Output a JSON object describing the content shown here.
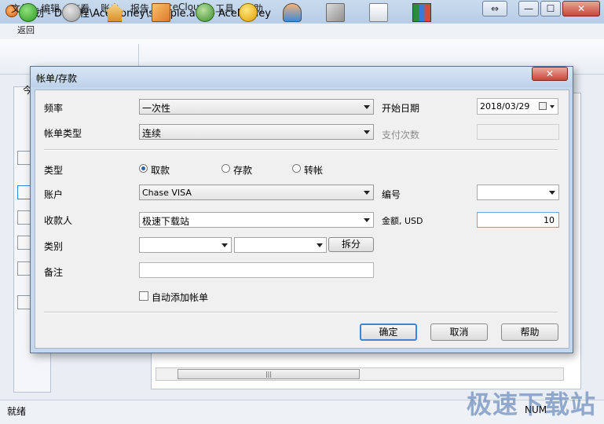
{
  "app": {
    "title": "计划 - D:\\教程\\AceMoney\\sample.amj - AceMoney",
    "window_buttons": {
      "restore": "⇔",
      "minimize": "—",
      "maximize": "☐",
      "close": "✕"
    }
  },
  "menu": [
    "文件",
    "编辑",
    "查看",
    "账户",
    "报告",
    "AceCloud",
    "工具",
    "帮助"
  ],
  "toolbar": {
    "back_label": "返回",
    "icons": [
      "back-icon",
      "forward-icon",
      "home-icon",
      "accounts-icon",
      "transfer-icon",
      "payment-icon",
      "payees-icon",
      "categories-icon",
      "schedule-icon",
      "reports-icon"
    ]
  },
  "background": {
    "left_panel_label": "今"
  },
  "dialog": {
    "title": "帐单/存款",
    "close": "✕",
    "frequency": {
      "label": "频率",
      "value": "一次性"
    },
    "start_date": {
      "label": "开始日期",
      "value": "2018/03/29"
    },
    "bill_type": {
      "label": "帐单类型",
      "value": "连续"
    },
    "payment_count": {
      "label": "支付次数",
      "value": ""
    },
    "type": {
      "label": "类型",
      "options": [
        "取款",
        "存款",
        "转帐"
      ],
      "selected": "取款"
    },
    "account": {
      "label": "账户",
      "value": "Chase VISA"
    },
    "number": {
      "label": "编号",
      "value": ""
    },
    "payee": {
      "label": "收款人",
      "value": "极速下载站"
    },
    "amount": {
      "label": "金额, USD",
      "value": "10"
    },
    "category": {
      "label": "类别",
      "value1": "",
      "value2": "",
      "split_label": "拆分"
    },
    "note": {
      "label": "备注",
      "value": ""
    },
    "auto_add": {
      "label": "自动添加帐单",
      "checked": false
    },
    "buttons": {
      "ok": "确定",
      "cancel": "取消",
      "help": "帮助"
    }
  },
  "statusbar": {
    "text": "就绪",
    "num": "NUM"
  },
  "watermark": "极速下载站"
}
